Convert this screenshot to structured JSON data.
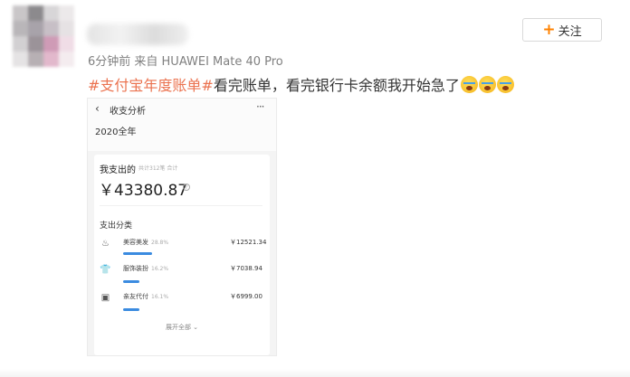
{
  "post": {
    "meta": "6分钟前 来自 HUAWEI Mate 40 Pro",
    "follow_label": "关注",
    "hashtag": "#支付宝年度账单#",
    "text": "看完账单，看完银行卡余额我开始急了"
  },
  "colors": {
    "hashtag": "#eb7350",
    "follow_plus": "#ff8200",
    "bar": "#3b8be0"
  },
  "screenshot": {
    "back_icon": "‹",
    "title": "收支分析",
    "more_icon": "···",
    "year": "2020全年",
    "card": {
      "label": "我支出的",
      "sub": "共计312笔 合计",
      "amount": "￥43380.87",
      "category_title": "支出分类",
      "categories": [
        {
          "icon": "beauty-icon",
          "glyph": "♨",
          "name": "美容美发",
          "pct": "28.8%",
          "value": "￥12521.34",
          "share": 0.288
        },
        {
          "icon": "clothes-icon",
          "glyph": "👕",
          "name": "服饰装扮",
          "pct": "16.2%",
          "value": "￥7038.94",
          "share": 0.162
        },
        {
          "icon": "gift-icon",
          "glyph": "▣",
          "name": "亲友代付",
          "pct": "16.1%",
          "value": "￥6999.00",
          "share": 0.161
        }
      ],
      "expand": "展开全部 ⌄"
    }
  }
}
